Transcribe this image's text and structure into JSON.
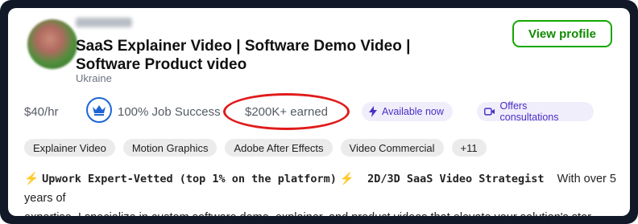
{
  "profile": {
    "title": "SaaS Explainer Video | Software Demo Video | Software Product video",
    "location": "Ukraine",
    "view_profile_label": "View profile"
  },
  "stats": {
    "rate": "$40/hr",
    "job_success": "100% Job Success",
    "earned": "$200K+ earned",
    "available": "Available now",
    "consultations": "Offers consultations"
  },
  "skills": [
    "Explainer Video",
    "Motion Graphics",
    "Adobe After Effects",
    "Video Commercial",
    "+11"
  ],
  "description": {
    "badge_emoji_left": "⚡",
    "badge_text": "Upwork Expert-Vetted (top 1% on the platform)",
    "badge_emoji_right": "⚡",
    "strategist": "2D/3D SaaS Video Strategist",
    "intro": "With over 5 years of",
    "line2": "expertise, I specialize in custom software demo, explainer, and product videos that elevate your solution's stor..."
  },
  "colors": {
    "accent_green": "#14a800",
    "highlight_red": "#e01b1b",
    "badge_purple": "#4b2fc4",
    "job_success_blue": "#1d65d6"
  },
  "icons": [
    "crown-icon",
    "lightning-icon",
    "video-camera-icon"
  ]
}
